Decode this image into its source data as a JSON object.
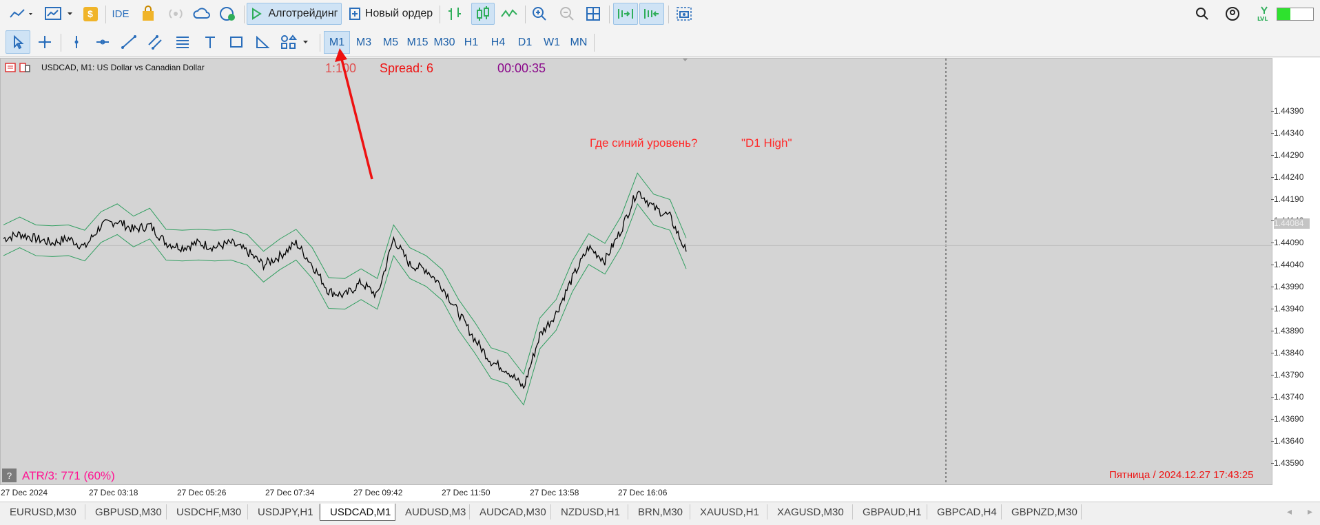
{
  "toolbar": {
    "algotrading_label": "Алготрейдинг",
    "new_order_label": "Новый ордер",
    "ide_label": "IDE"
  },
  "timeframes": [
    "M1",
    "M3",
    "M5",
    "M15",
    "M30",
    "H1",
    "H4",
    "D1",
    "W1",
    "MN"
  ],
  "chart": {
    "symbol_title": "USDCAD, M1:  US Dollar vs Canadian Dollar",
    "leverage": "1:100",
    "spread": "Spread: 6",
    "timer": "00:00:35",
    "question_label": "Где синий уровень?",
    "d1_label": "\"D1 High\"",
    "atr_label": "ATR/3: 771 (60%)",
    "datetime_label": "Пятница / 2024.12.27 17:43:25",
    "help_button": "?",
    "current_price": "1.44084",
    "colors": {
      "leverage": "#e05050",
      "spread": "#ee1111",
      "timer": "#8b0a8b",
      "annotation": "#ff2a2a",
      "atr": "#ff1493",
      "bands": "#2f9e5f"
    }
  },
  "chart_data": {
    "type": "line",
    "title": "USDCAD, M1:  US Dollar vs Canadian Dollar",
    "ylim": [
      1.4354,
      1.4451
    ],
    "y_ticks": [
      "1.44390",
      "1.44340",
      "1.44290",
      "1.44240",
      "1.44190",
      "1.44140",
      "1.44090",
      "1.44040",
      "1.43990",
      "1.43940",
      "1.43890",
      "1.43840",
      "1.43790",
      "1.43740",
      "1.43690",
      "1.43640",
      "1.43590"
    ],
    "x_ticks": [
      "27 Dec 2024",
      "27 Dec 03:18",
      "27 Dec 05:26",
      "27 Dec 07:34",
      "27 Dec 09:42",
      "27 Dec 11:50",
      "27 Dec 13:58",
      "27 Dec 16:06"
    ],
    "series": [
      {
        "values": [
          1.441,
          1.4411,
          1.441,
          1.4409,
          1.441,
          1.4408,
          1.4413,
          1.4414,
          1.4412,
          1.4413,
          1.4409,
          1.4408,
          1.4409,
          1.4408,
          1.4409,
          1.4407,
          1.4404,
          1.4406,
          1.4409,
          1.4404,
          1.4398,
          1.4397,
          1.44,
          1.4397,
          1.441,
          1.4404,
          1.4403,
          1.4399,
          1.4393,
          1.4387,
          1.4382,
          1.438,
          1.4376,
          1.4388,
          1.4393,
          1.4401,
          1.4408,
          1.4405,
          1.4412,
          1.4421,
          1.4417,
          1.4415,
          1.4407
        ]
      }
    ]
  },
  "tabs": [
    "EURUSD,M30",
    "GBPUSD,M30",
    "USDCHF,M30",
    "USDJPY,H1",
    "USDCAD,M1",
    "AUDUSD,M3",
    "AUDCAD,M30",
    "NZDUSD,H1",
    "BRN,M30",
    "XAUUSD,H1",
    "XAGUSD,M30",
    "GBPAUD,H1",
    "GBPCAD,H4",
    "GBPNZD,M30"
  ]
}
